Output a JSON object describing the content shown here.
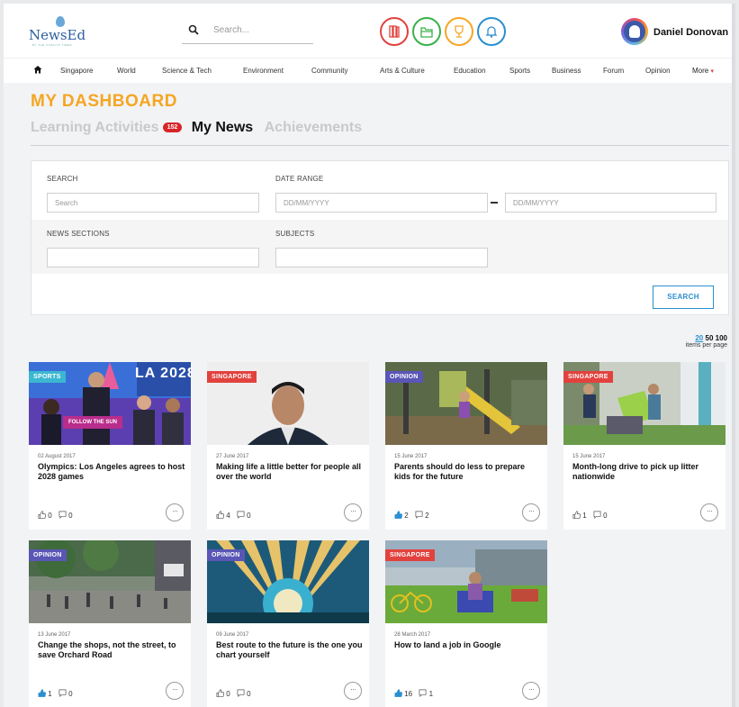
{
  "header": {
    "logo_text": "NewsEd",
    "logo_tagline": "BY THE STRAITS TIMES",
    "search_placeholder": "Search...",
    "icons": [
      "library-icon",
      "folder-icon",
      "trophy-icon",
      "bell-icon"
    ],
    "user_name": "Daniel Donovan",
    "user_caret": "⌄"
  },
  "nav": {
    "items": [
      "Singapore",
      "World",
      "Science & Tech",
      "Environment",
      "Community",
      "Arts & Culture",
      "Education",
      "Sports",
      "Business",
      "Forum",
      "Opinion"
    ],
    "more_label": "More",
    "more_caret": "▾"
  },
  "dashboard": {
    "title": "MY DASHBOARD",
    "tabs": {
      "learning": "Learning Activities",
      "learning_badge": "152",
      "news": "My News",
      "achievements": "Achievements"
    }
  },
  "filter": {
    "search_label": "SEARCH",
    "search_placeholder": "Search",
    "date_label": "DATE RANGE",
    "date_from_placeholder": "DD/MM/YYYY",
    "date_to_placeholder": "DD/MM/YYYY",
    "sections_label": "NEWS SECTIONS",
    "subjects_label": "SUBJECTS",
    "search_button": "SEARCH"
  },
  "pagination": {
    "options": [
      "20",
      "50",
      "100"
    ],
    "selected": "20",
    "label": "items per page"
  },
  "colors": {
    "accent": "#f5a623",
    "link": "#2a8fd0",
    "sports": "#3bb7d1",
    "singapore": "#e2423e",
    "opinion": "#5a56b6"
  },
  "cards": [
    {
      "category": "SPORTS",
      "date": "02 August 2017",
      "title": "Olympics: Los Angeles agrees to host 2028 games",
      "likes": "0",
      "comments": "0",
      "liked": false,
      "image_text": "LA 2028",
      "banner": "FOLLOW THE SUN"
    },
    {
      "category": "SINGAPORE",
      "date": "27 June 2017",
      "title": "Making life a little better for people all over the world",
      "likes": "4",
      "comments": "0",
      "liked": false
    },
    {
      "category": "OPINION",
      "date": "15 June 2017",
      "title": "Parents should do less to prepare kids for the future",
      "likes": "2",
      "comments": "2",
      "liked": true
    },
    {
      "category": "SINGAPORE",
      "date": "15 June 2017",
      "title": "Month-long drive to pick up litter nationwide",
      "likes": "1",
      "comments": "0",
      "liked": false
    },
    {
      "category": "OPINION",
      "date": "13 June 2017",
      "title": "Change the shops, not the street, to save Orchard Road",
      "likes": "1",
      "comments": "0",
      "liked": true
    },
    {
      "category": "OPINION",
      "date": "09 June 2017",
      "title": "Best route to the future is the one you chart yourself",
      "likes": "0",
      "comments": "0",
      "liked": false
    },
    {
      "category": "SINGAPORE",
      "date": "28 March 2017",
      "title": "How to land a job in Google",
      "likes": "16",
      "comments": "1",
      "liked": true
    }
  ],
  "more_glyph": "···"
}
